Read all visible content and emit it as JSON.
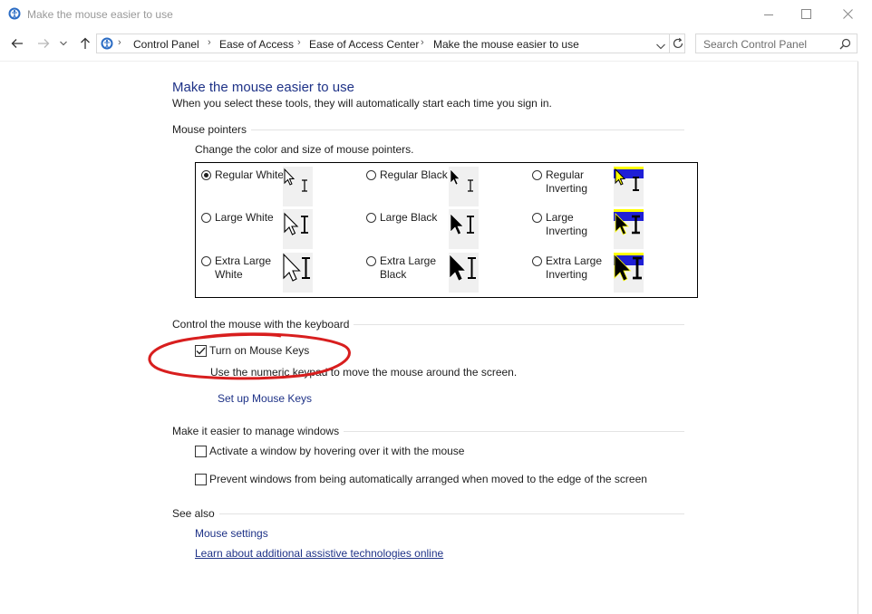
{
  "window": {
    "title": "Make the mouse easier to use",
    "controls": {
      "minimize": "minimize-icon",
      "maximize": "maximize-icon",
      "close": "close-icon"
    }
  },
  "address_bar": {
    "breadcrumbs": [
      "Control Panel",
      "Ease of Access",
      "Ease of Access Center",
      "Make the mouse easier to use"
    ],
    "search_placeholder": "Search Control Panel"
  },
  "page": {
    "heading": "Make the mouse easier to use",
    "description": "When you select these tools, they will automatically start each time you sign in."
  },
  "pointers": {
    "group_title": "Mouse pointers",
    "subtitle": "Change the color and size of mouse pointers.",
    "options": [
      {
        "label": "Regular White",
        "scheme": "white",
        "size": "regular",
        "selected": true
      },
      {
        "label": "Regular Black",
        "scheme": "black",
        "size": "regular",
        "selected": false
      },
      {
        "label": "Regular Inverting",
        "scheme": "inverting",
        "size": "regular",
        "selected": false
      },
      {
        "label": "Large White",
        "scheme": "white",
        "size": "large",
        "selected": false
      },
      {
        "label": "Large Black",
        "scheme": "black",
        "size": "large",
        "selected": false
      },
      {
        "label": "Large Inverting",
        "scheme": "inverting",
        "size": "large",
        "selected": false
      },
      {
        "label": "Extra Large White",
        "scheme": "white",
        "size": "xlarge",
        "selected": false
      },
      {
        "label": "Extra Large Black",
        "scheme": "black",
        "size": "xlarge",
        "selected": false
      },
      {
        "label": "Extra Large Inverting",
        "scheme": "inverting",
        "size": "xlarge",
        "selected": false
      }
    ]
  },
  "keyboard": {
    "group_title": "Control the mouse with the keyboard",
    "mouse_keys_label": "Turn on Mouse Keys",
    "mouse_keys_checked": true,
    "mouse_keys_desc": "Use the numeric keypad to move the mouse around the screen.",
    "setup_link": "Set up Mouse Keys",
    "annotation_color": "#d81e1e"
  },
  "windows": {
    "group_title": "Make it easier to manage windows",
    "options": [
      {
        "label": "Activate a window by hovering over it with the mouse",
        "checked": false
      },
      {
        "label": "Prevent windows from being automatically arranged when moved to the edge of the screen",
        "checked": false
      }
    ]
  },
  "see_also": {
    "group_title": "See also",
    "links": [
      "Mouse settings",
      "Learn about additional assistive technologies online"
    ]
  },
  "colors": {
    "link": "#1e3287",
    "inverting_yellow": "#ffff00",
    "inverting_blue": "#1f1fd6"
  }
}
